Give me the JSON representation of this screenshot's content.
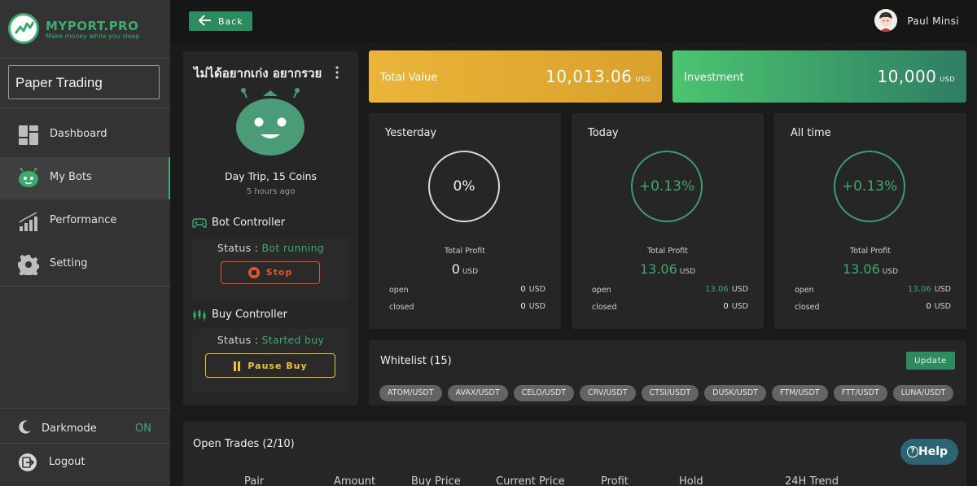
{
  "brand": {
    "name": "MYPORT.PRO",
    "tagline": "Make money while you sleep"
  },
  "sidebar": {
    "mode": "Paper Trading",
    "items": [
      {
        "label": "Dashboard",
        "icon": "dashboard-icon"
      },
      {
        "label": "My Bots",
        "icon": "bot-icon",
        "active": true
      },
      {
        "label": "Performance",
        "icon": "chart-icon"
      },
      {
        "label": "Setting",
        "icon": "gear-icon"
      }
    ],
    "darkmode": {
      "label": "Darkmode",
      "state": "ON"
    },
    "logout": "Logout"
  },
  "topbar": {
    "back_label": "Back",
    "user_name": "Paul Minsi"
  },
  "bot": {
    "title": "ไม่ได้อยากเก่ง อยากรวย",
    "name": "Day Trip, 15 Coins",
    "time": "5 hours ago",
    "bot_controller": {
      "heading": "Bot Controller",
      "status_label": "Status :",
      "status_value": "Bot running",
      "button": "Stop"
    },
    "buy_controller": {
      "heading": "Buy Controller",
      "status_label": "Status :",
      "status_value": "Started buy",
      "button": "Pause Buy"
    }
  },
  "summary": {
    "total_value": {
      "label": "Total Value",
      "amount": "10,013.06",
      "unit": "USD"
    },
    "investment": {
      "label": "Investment",
      "amount": "10,000",
      "unit": "USD"
    }
  },
  "periods": [
    {
      "title": "Yesterday",
      "percent": "0%",
      "tp_label": "Total Profit",
      "tp_value": "0",
      "unit": "USD",
      "open_label": "open",
      "open": "0",
      "closed_label": "closed",
      "closed": "0"
    },
    {
      "title": "Today",
      "percent": "+0.13%",
      "tp_label": "Total Profit",
      "tp_value": "13.06",
      "unit": "USD",
      "open_label": "open",
      "open": "13.06",
      "closed_label": "closed",
      "closed": "0"
    },
    {
      "title": "All time",
      "percent": "+0.13%",
      "tp_label": "Total Profit",
      "tp_value": "13.06",
      "unit": "USD",
      "open_label": "open",
      "open": "13.06",
      "closed_label": "closed",
      "closed": "0"
    }
  ],
  "whitelist": {
    "title": "Whitelist (15)",
    "update_label": "Update",
    "pairs": [
      "ATOM/USDT",
      "AVAX/USDT",
      "CELO/USDT",
      "CRV/USDT",
      "CTSI/USDT",
      "DUSK/USDT",
      "FTM/USDT",
      "FTT/USDT",
      "LUNA/USDT"
    ]
  },
  "trades": {
    "title": "Open Trades (2/10)",
    "columns": [
      "Pair",
      "Amount",
      "Buy Price",
      "Current Price",
      "Profit",
      "Hold",
      "24H Trend"
    ]
  },
  "help_label": "Help",
  "colors": {
    "accent": "#3bab6e",
    "total_value": "#eab53a",
    "investment": "#4cc570",
    "stop": "#e2562b",
    "pause": "#f2c230"
  }
}
